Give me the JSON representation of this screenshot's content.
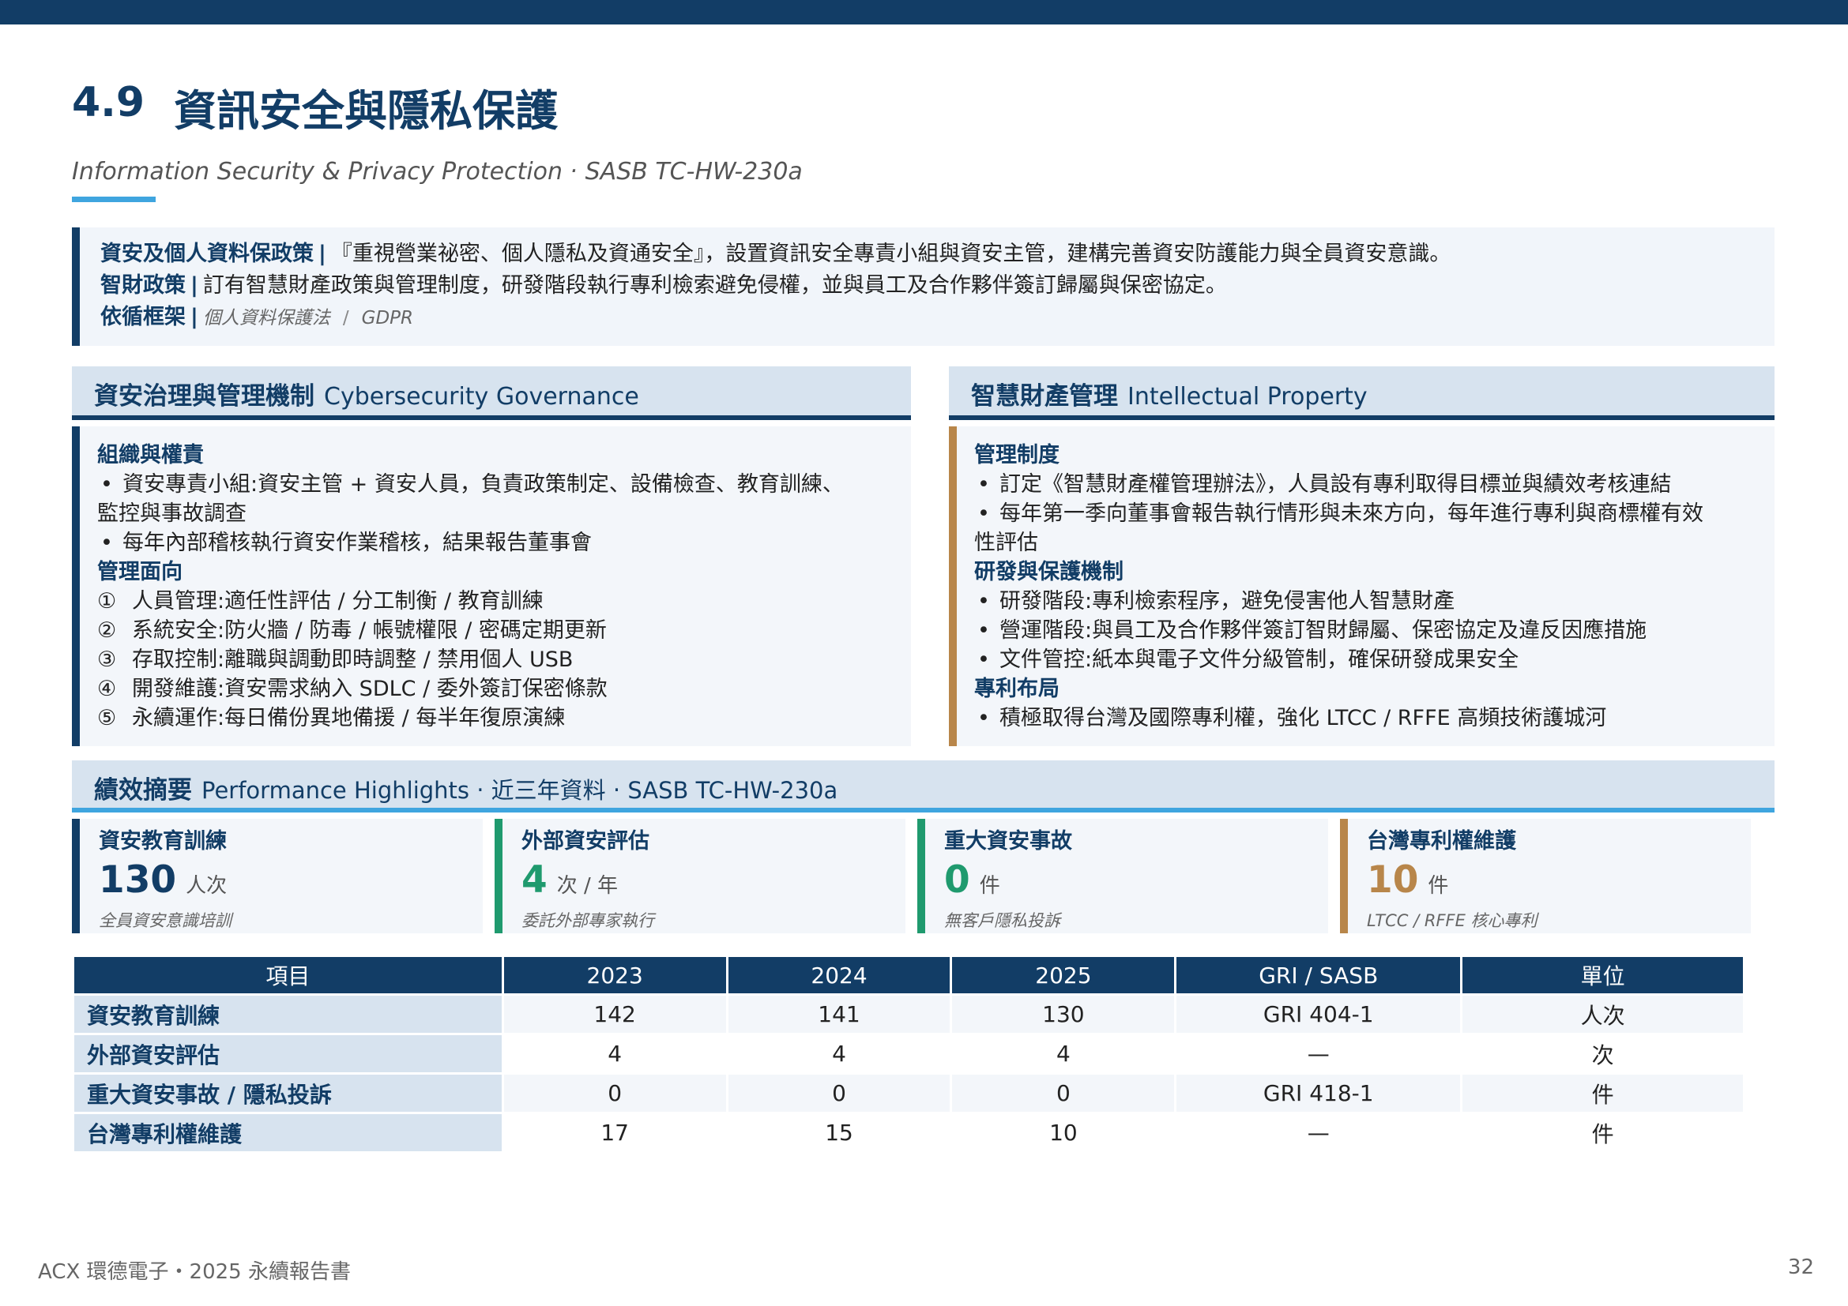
{
  "header": {
    "number": "4.9",
    "title": "資訊安全與隱私保護",
    "subtitle": "Information Security & Privacy Protection ‧ SASB TC-HW-230a",
    "colors": {
      "navy": "#123d66",
      "accent": "#3fa5df",
      "gold": "#b8864a",
      "green": "#1f9a6e"
    }
  },
  "policy": {
    "row1_label": "資安及個人資料保政策",
    "row1_text": "『重視營業祕密、個人隱私及資通安全』，設置資訊安全專責小組與資安主管，建構完善資安防護能力與全員資安意識。",
    "row2_label": "智財政策",
    "row2_text": "訂有智慧財產政策與管理制度，研發階段執行專利檢索避免侵權，並與員工及合作夥伴簽訂歸屬與保密協定。",
    "row3_label": "依循框架",
    "frameworks": [
      "個人資料保護法",
      "GDPR"
    ],
    "separator": "|"
  },
  "governance": {
    "title": "資安治理與管理機制",
    "title_en": "Cybersecurity Governance",
    "org_heading": "組織與權責",
    "org_items": [
      "資安專責小組:資安主管 + 資安人員，負責政策制定、設備檢查、教育訓練、",
      "監控與事故調查",
      "每年內部稽核執行資安作業稽核，結果報告董事會"
    ],
    "mgmt_heading": "管理面向",
    "mgmt_items": [
      {
        "num": "①",
        "text": "人員管理:適任性評估 / 分工制衡 / 教育訓練"
      },
      {
        "num": "②",
        "text": "系統安全:防火牆 / 防毒 / 帳號權限 / 密碼定期更新"
      },
      {
        "num": "③",
        "text": "存取控制:離職與調動即時調整 / 禁用個人 USB"
      },
      {
        "num": "④",
        "text": "開發維護:資安需求納入 SDLC / 委外簽訂保密條款"
      },
      {
        "num": "⑤",
        "text": "永續運作:每日備份異地備援 / 每半年復原演練"
      }
    ],
    "bullet": "•"
  },
  "ip": {
    "title": "智慧財產管理",
    "title_en": "Intellectual Property",
    "sys_heading": "管理制度",
    "sys_items": [
      "訂定《智慧財產權管理辦法》，人員設有專利取得目標並與績效考核連結",
      "每年第一季向董事會報告執行情形與未來方向，每年進行專利與商標權有效",
      "性評估"
    ],
    "rd_heading": "研發與保護機制",
    "rd_items": [
      "研發階段:專利檢索程序，避免侵害他人智慧財產",
      "營運階段:與員工及合作夥伴簽訂智財歸屬、保密協定及違反因應措施",
      "文件管控:紙本與電子文件分級管制，確保研發成果安全"
    ],
    "patent_heading": "專利布局",
    "patent_items": [
      "積極取得台灣及國際專利權，強化 LTCC / RFFE 高頻技術護城河"
    ]
  },
  "performance": {
    "title": "績效摘要",
    "title_en": "Performance Highlights ‧ 近三年資料 ‧ SASB TC-HW-230a",
    "kpis": [
      {
        "label": "資安教育訓練",
        "value": "130",
        "unit": "人次",
        "note": "全員資安意識培訓",
        "color": "#123d66"
      },
      {
        "label": "外部資安評估",
        "value": "4",
        "unit": "次 / 年",
        "note": "委託外部專家執行",
        "color": "#1f9a6e"
      },
      {
        "label": "重大資安事故",
        "value": "0",
        "unit": "件",
        "note": "無客戶隱私投訴",
        "color": "#1f9a6e"
      },
      {
        "label": "台灣專利權維護",
        "value": "10",
        "unit": "件",
        "note": "LTCC / RFFE 核心專利",
        "color": "#b8864a"
      }
    ]
  },
  "table": {
    "headers": [
      "項目",
      "2023",
      "2024",
      "2025",
      "GRI / SASB",
      "單位"
    ],
    "rows": [
      [
        "資安教育訓練",
        "142",
        "141",
        "130",
        "GRI 404-1",
        "人次"
      ],
      [
        "外部資安評估",
        "4",
        "4",
        "4",
        "—",
        "次"
      ],
      [
        "重大資安事故 / 隱私投訴",
        "0",
        "0",
        "0",
        "GRI 418-1",
        "件"
      ],
      [
        "台灣專利權維護",
        "17",
        "15",
        "10",
        "—",
        "件"
      ]
    ]
  },
  "footer": {
    "text": "ACX 環德電子・2025 永續報告書",
    "page": "32"
  }
}
